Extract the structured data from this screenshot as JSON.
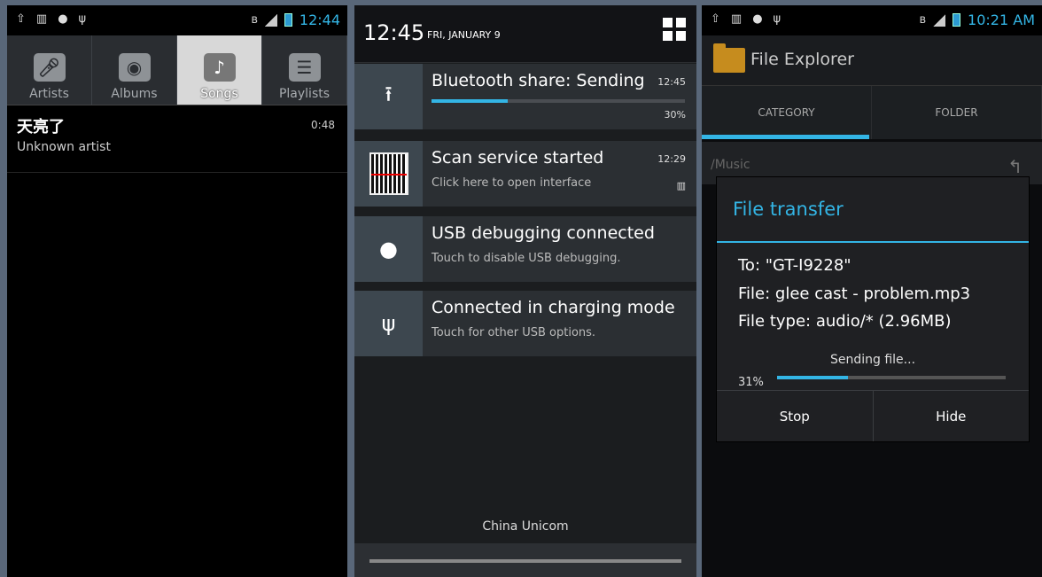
{
  "colors": {
    "accent": "#33b5e5",
    "progress_track": "#4a4d52"
  },
  "music": {
    "status_icons": [
      "upload-icon",
      "barcode-icon",
      "android-icon",
      "usb-icon"
    ],
    "status_time": "12:44",
    "tabs": [
      {
        "label": "Artists",
        "icon": "microphone-icon",
        "active": false
      },
      {
        "label": "Albums",
        "icon": "album-icon",
        "active": false
      },
      {
        "label": "Songs",
        "icon": "music-note-icon",
        "active": true
      },
      {
        "label": "Playlists",
        "icon": "list-icon",
        "active": false
      }
    ],
    "song": {
      "title": "天亮了",
      "artist": "Unknown artist",
      "time": "0:48"
    }
  },
  "notifications": {
    "time": "12:45",
    "date": "FRI, JANUARY 9",
    "items": [
      {
        "title": "Bluetooth share: Sending",
        "time": "12:45",
        "progress": 30,
        "progress_label": "30%",
        "icon": "upload-icon"
      },
      {
        "title": "Scan service started",
        "subtitle": "Click here to open interface",
        "time": "12:29",
        "icon": "barcode-icon"
      },
      {
        "title": "USB debugging connected",
        "subtitle": "Touch to disable USB debugging.",
        "icon": "android-icon"
      },
      {
        "title": "Connected in charging mode",
        "subtitle": "Touch for other USB options.",
        "icon": "usb-icon"
      }
    ],
    "carrier": "China Unicom"
  },
  "explorer": {
    "status_time": "10:21 AM",
    "app_title": "File Explorer",
    "tabs": [
      "CATEGORY",
      "FOLDER"
    ],
    "path": "/Music",
    "dialog": {
      "title": "File transfer",
      "to": "To: \"GT-I9228\"",
      "file": "File: glee cast - problem.mp3",
      "file_type": "File type: audio/* (2.96MB)",
      "status": "Sending file...",
      "percent_label": "31%",
      "progress": 31,
      "stop_label": "Stop",
      "hide_label": "Hide"
    }
  }
}
